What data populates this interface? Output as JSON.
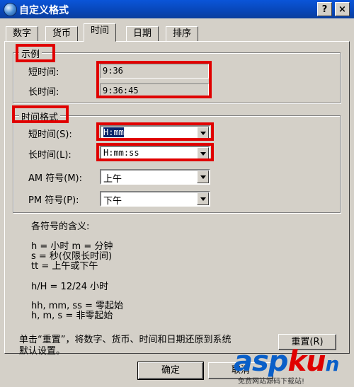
{
  "window": {
    "title": "自定义格式",
    "help_glyph": "?",
    "close_glyph": "×"
  },
  "tabs": [
    {
      "label": "数字"
    },
    {
      "label": "货币"
    },
    {
      "label": "时间",
      "active": true
    },
    {
      "label": "日期"
    },
    {
      "label": "排序"
    }
  ],
  "sample": {
    "legend": "示例",
    "short_label": "短时间:",
    "short_value": "9:36",
    "long_label": "长时间:",
    "long_value": "9:36:45"
  },
  "time_format": {
    "legend": "时间格式",
    "short_label": "短时间(S):",
    "short_value": "H:mm",
    "long_label": "长时间(L):",
    "long_value": "H:mm:ss",
    "am_label": "AM 符号(M):",
    "am_value": "上午",
    "pm_label": "PM 符号(P):",
    "pm_value": "下午"
  },
  "legend_info": {
    "heading": "各符号的含义:",
    "lines": [
      "h = 小时    m = 分钟",
      "s = 秒(仅限长时间)",
      "tt = 上午或下午",
      "h/H = 12/24 小时",
      "hh, mm, ss = 零起始",
      "h, m, s = 非零起始"
    ]
  },
  "reset": {
    "note_line1": "单击“重置”，将数字、货币、时间和日期还原到系统",
    "note_line2": "默认设置。",
    "button_label": "重置(R)"
  },
  "footer": {
    "ok_label": "确定",
    "cancel_label": "取消"
  },
  "watermark": {
    "brand_a": "asp",
    "brand_b": "ku",
    "tail": "n",
    "sub": "免费网站源码下载站!"
  },
  "colors": {
    "highlight": "#e00000",
    "titlebar": "#0a55d8",
    "face": "#d4d0c8"
  }
}
